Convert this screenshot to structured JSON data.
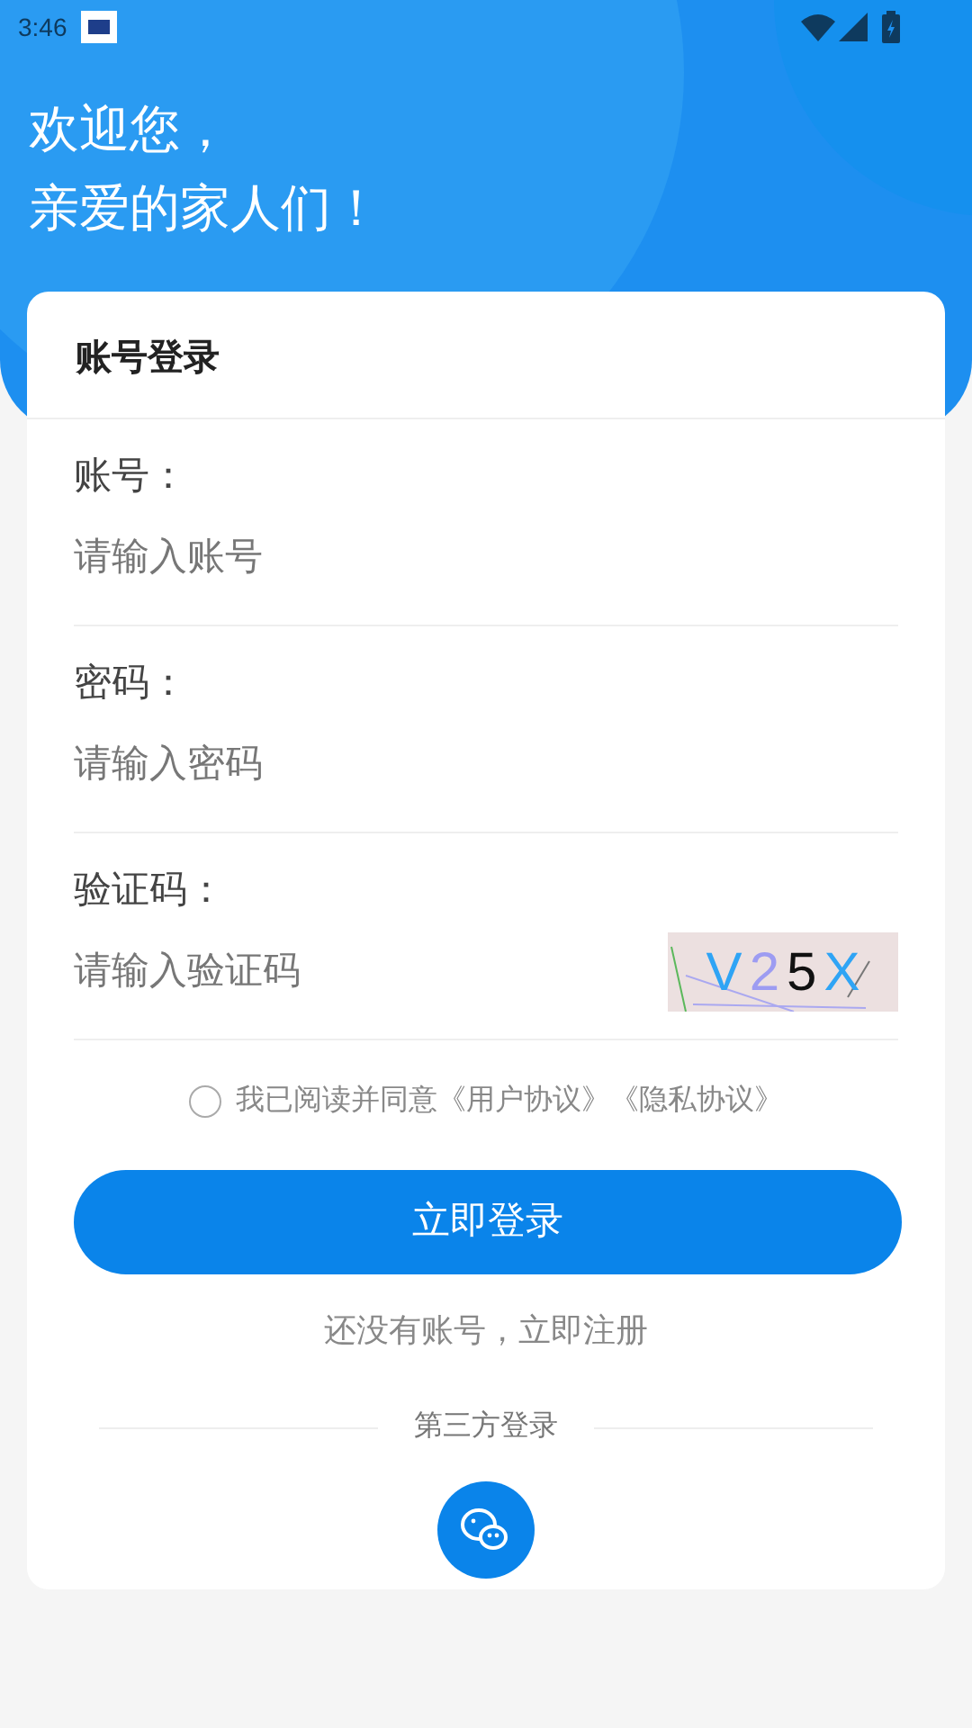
{
  "status_bar": {
    "time": "3:46"
  },
  "greeting": [
    "欢迎您，",
    "亲爱的家人们！"
  ],
  "card": {
    "title": "账号登录",
    "fields": [
      {
        "label": "账号：",
        "placeholder": "请输入账号",
        "kind": "text"
      },
      {
        "label": "密码：",
        "placeholder": "请输入密码",
        "kind": "password"
      },
      {
        "label": "验证码：",
        "placeholder": "请输入验证码",
        "kind": "captcha"
      }
    ],
    "captcha": [
      {
        "text": "V",
        "color": "#2fa4f5"
      },
      {
        "text": "2",
        "color": "#9d9cf2"
      },
      {
        "text": "5",
        "color": "#111111"
      },
      {
        "text": "X",
        "color": "#2fa4f5"
      }
    ],
    "agreement": {
      "checked": false,
      "text": "我已阅读并同意《用户协议》《隐私协议》"
    },
    "login_button": "立即登录",
    "register_link": "还没有账号，立即注册",
    "third_party": "第三方登录"
  }
}
